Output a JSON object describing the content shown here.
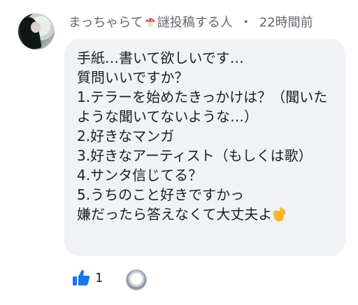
{
  "comment": {
    "author": "まっちゃらて",
    "author_suffix": "謎投稿する人",
    "separator": "・",
    "timestamp": "22時間前",
    "text_lines": [
      "手紙…書いて欲しいです…",
      "質問いいですか？",
      "1.テラーを始めたきっかけは？（聞いたような聞いてないような…）",
      "2.好きなマンガ",
      "3.好きなアーティスト（もしくは歌）",
      "4.サンタ信じてる？",
      "5.うちのこと好きですかっ",
      "嫌だったら答えなくて大丈夫よ"
    ],
    "emoji": "ok-hand",
    "like_count": "1"
  },
  "icons": {
    "name_emoji": "mushroom-icon",
    "like": "thumbs-up-icon"
  },
  "colors": {
    "bubble": "#f0f2f5",
    "meta_text": "#606770",
    "like_blue": "#1877f2"
  }
}
